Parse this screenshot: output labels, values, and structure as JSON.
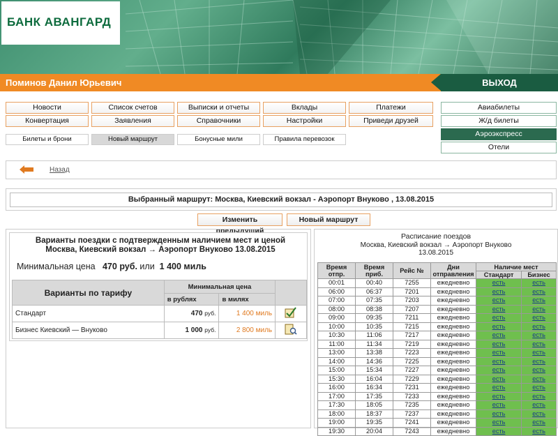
{
  "bank": {
    "logo_text": "БАНК АВАНГАРД"
  },
  "header": {
    "user_name": "Поминов Данил Юрьевич",
    "logout_label": "ВЫХОД"
  },
  "menu": {
    "row1": [
      "Новости",
      "Список счетов",
      "Выписки и отчеты",
      "Вклады",
      "Платежи"
    ],
    "row2": [
      "Конвертация",
      "Заявления",
      "Справочники",
      "Настройки",
      "Приведи друзей"
    ]
  },
  "right_menu": [
    "Авиабилеты",
    "Ж/д билеты",
    "Аэроэкспресс",
    "Отели"
  ],
  "right_menu_active": "Аэроэкспресс",
  "submenu": [
    "Билеты и брони",
    "Новый маршрут",
    "Бонусные мили",
    "Правила перевозок"
  ],
  "submenu_active": "Новый маршрут",
  "back": {
    "label": "Назад"
  },
  "route": {
    "text": "Выбранный маршрут:  Москва, Киевский вокзал - Аэропорт Внуково , 13.08.2015"
  },
  "actions": {
    "change_prev": "Изменить предыдущий",
    "new_route": "Новый маршрут"
  },
  "left": {
    "title_line1": "Варианты поездки с подтвержденным наличием мест и ценой",
    "title_line2": "Москва, Киевский вокзал  →  Аэропорт Внуково 13.08.2015",
    "min_price_label": "Минимальная цена",
    "min_price_rub": "470 руб.",
    "or": "или",
    "min_price_miles": "1 400 миль",
    "tariff_header": "Варианты по тарифу",
    "min_price_header": "Минимальная цена",
    "col_rub": "в рублях",
    "col_miles": "в милях",
    "tariffs": [
      {
        "name": "Стандарт",
        "rub": "470",
        "rub_unit": "руб.",
        "miles": "1 400 миль"
      },
      {
        "name": "Бизнес Киевский — Внуково",
        "rub": "1 000",
        "rub_unit": "руб.",
        "miles": "2 800 миль"
      }
    ]
  },
  "schedule": {
    "title": "Расписание поездов",
    "subtitle1": "Москва, Киевский вокзал  →  Аэропорт Внуково",
    "subtitle2": "13.08.2015",
    "headers": {
      "dep": "Время отпр.",
      "arr": "Время приб.",
      "trip": "Рейс №",
      "days": "Дни отправления",
      "avail": "Наличие мест",
      "std": "Стандарт",
      "biz": "Бизнес"
    },
    "rows": [
      [
        "00:01",
        "00:40",
        "7255",
        "ежедневно",
        "есть",
        "есть"
      ],
      [
        "06:00",
        "06:37",
        "7201",
        "ежедневно",
        "есть",
        "есть"
      ],
      [
        "07:00",
        "07:35",
        "7203",
        "ежедневно",
        "есть",
        "есть"
      ],
      [
        "08:00",
        "08:38",
        "7207",
        "ежедневно",
        "есть",
        "есть"
      ],
      [
        "09:00",
        "09:35",
        "7211",
        "ежедневно",
        "есть",
        "есть"
      ],
      [
        "10:00",
        "10:35",
        "7215",
        "ежедневно",
        "есть",
        "есть"
      ],
      [
        "10:30",
        "11:06",
        "7217",
        "ежедневно",
        "есть",
        "есть"
      ],
      [
        "11:00",
        "11:34",
        "7219",
        "ежедневно",
        "есть",
        "есть"
      ],
      [
        "13:00",
        "13:38",
        "7223",
        "ежедневно",
        "есть",
        "есть"
      ],
      [
        "14:00",
        "14:36",
        "7225",
        "ежедневно",
        "есть",
        "есть"
      ],
      [
        "15:00",
        "15:34",
        "7227",
        "ежедневно",
        "есть",
        "есть"
      ],
      [
        "15:30",
        "16:04",
        "7229",
        "ежедневно",
        "есть",
        "есть"
      ],
      [
        "16:00",
        "16:34",
        "7231",
        "ежедневно",
        "есть",
        "есть"
      ],
      [
        "17:00",
        "17:35",
        "7233",
        "ежедневно",
        "есть",
        "есть"
      ],
      [
        "17:30",
        "18:05",
        "7235",
        "ежедневно",
        "есть",
        "есть"
      ],
      [
        "18:00",
        "18:37",
        "7237",
        "ежедневно",
        "есть",
        "есть"
      ],
      [
        "19:00",
        "19:35",
        "7241",
        "ежедневно",
        "есть",
        "есть"
      ],
      [
        "19:30",
        "20:04",
        "7243",
        "ежедневно",
        "есть",
        "есть"
      ]
    ]
  },
  "colors": {
    "orange": "#f08a24",
    "dark_green": "#1a5c41",
    "available": "#6fbf4e"
  }
}
